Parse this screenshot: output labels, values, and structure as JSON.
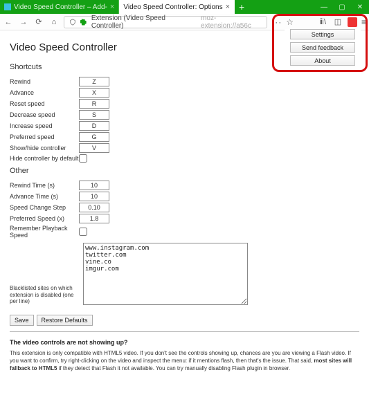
{
  "window": {
    "tabs": [
      {
        "title": "Video Speed Controller – Add-",
        "active": false
      },
      {
        "title": "Video Speed Controller: Options",
        "active": true
      }
    ]
  },
  "urlbar": {
    "ext_label": "Extension (Video Speed Controller)",
    "url_tail": "moz-extension://a56c",
    "placeholder": ""
  },
  "ext_menu": {
    "settings": "Settings",
    "feedback": "Send feedback",
    "about": "About"
  },
  "page": {
    "title": "Video Speed Controller",
    "sections": {
      "shortcuts": {
        "heading": "Shortcuts",
        "rows": [
          {
            "label": "Rewind",
            "value": "Z"
          },
          {
            "label": "Advance",
            "value": "X"
          },
          {
            "label": "Reset speed",
            "value": "R"
          },
          {
            "label": "Decrease speed",
            "value": "S"
          },
          {
            "label": "Increase speed",
            "value": "D"
          },
          {
            "label": "Preferred speed",
            "value": "G"
          },
          {
            "label": "Show/hide controller",
            "value": "V"
          }
        ],
        "hide_default_label": "Hide controller by default"
      },
      "other": {
        "heading": "Other",
        "rows": [
          {
            "label": "Rewind Time (s)",
            "value": "10"
          },
          {
            "label": "Advance Time (s)",
            "value": "10"
          },
          {
            "label": "Speed Change Step",
            "value": "0.10"
          },
          {
            "label": "Preferred Speed (x)",
            "value": "1.8"
          }
        ],
        "remember_label": "Remember Playback Speed",
        "blacklist_label": "Blacklisted sites on which extension is disabled (one per line)",
        "blacklist_value": "www.instagram.com\ntwitter.com\nvine.co\nimgur.com"
      }
    },
    "buttons": {
      "save": "Save",
      "restore": "Restore Defaults"
    },
    "faq": {
      "title": "The video controls are not showing up?",
      "body_pre": "This extension is only compatible with HTML5 video. If you don't see the controls showing up, chances are you are viewing a Flash video. If you want to confirm, try right-clicking on the video and inspect the menu: if it mentions flash, then that's the issue. That said, ",
      "body_bold": "most sites will fallback to HTML5",
      "body_post": " if they detect that Flash it not available. You can try manually disabling Flash plugin in browser."
    }
  }
}
